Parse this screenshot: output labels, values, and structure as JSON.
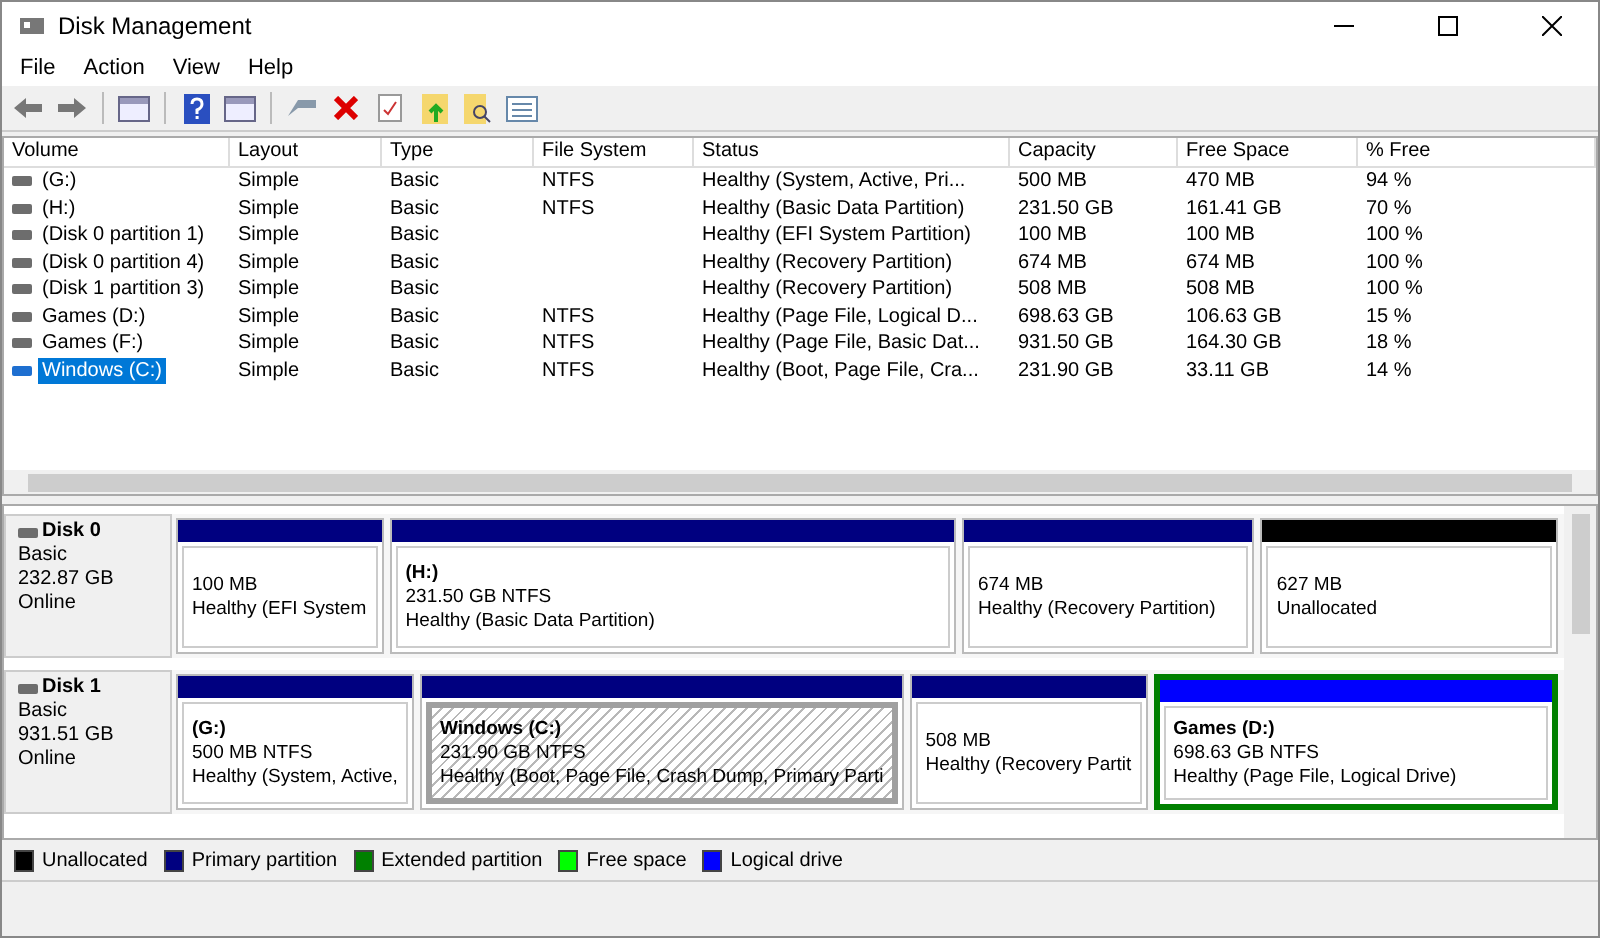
{
  "window": {
    "title": "Disk Management"
  },
  "menu": [
    "File",
    "Action",
    "View",
    "Help"
  ],
  "table": {
    "columns": [
      "Volume",
      "Layout",
      "Type",
      "File System",
      "Status",
      "Capacity",
      "Free Space",
      "% Free"
    ],
    "rows": [
      {
        "cells": [
          "(G:)",
          "Simple",
          "Basic",
          "NTFS",
          "Healthy (System, Active, Pri...",
          "500 MB",
          "470 MB",
          "94 %"
        ],
        "selected": false
      },
      {
        "cells": [
          "(H:)",
          "Simple",
          "Basic",
          "NTFS",
          "Healthy (Basic Data Partition)",
          "231.50 GB",
          "161.41 GB",
          "70 %"
        ],
        "selected": false
      },
      {
        "cells": [
          "(Disk 0 partition 1)",
          "Simple",
          "Basic",
          "",
          "Healthy (EFI System Partition)",
          "100 MB",
          "100 MB",
          "100 %"
        ],
        "selected": false
      },
      {
        "cells": [
          "(Disk 0 partition 4)",
          "Simple",
          "Basic",
          "",
          "Healthy (Recovery Partition)",
          "674 MB",
          "674 MB",
          "100 %"
        ],
        "selected": false
      },
      {
        "cells": [
          "(Disk 1 partition 3)",
          "Simple",
          "Basic",
          "",
          "Healthy (Recovery Partition)",
          "508 MB",
          "508 MB",
          "100 %"
        ],
        "selected": false
      },
      {
        "cells": [
          "Games (D:)",
          "Simple",
          "Basic",
          "NTFS",
          "Healthy (Page File, Logical D...",
          "698.63 GB",
          "106.63 GB",
          "15 %"
        ],
        "selected": false
      },
      {
        "cells": [
          "Games (F:)",
          "Simple",
          "Basic",
          "NTFS",
          "Healthy (Page File, Basic Dat...",
          "931.50 GB",
          "164.30 GB",
          "18 %"
        ],
        "selected": false
      },
      {
        "cells": [
          "Windows (C:)",
          "Simple",
          "Basic",
          "NTFS",
          "Healthy (Boot, Page File, Cra...",
          "231.90 GB",
          "33.11 GB",
          "14 %"
        ],
        "selected": true
      }
    ]
  },
  "disks": [
    {
      "name": "Disk 0",
      "type": "Basic",
      "size": "232.87 GB",
      "state": "Online",
      "partitions": [
        {
          "lines": [
            "100 MB",
            "Healthy (EFI System"
          ],
          "color": "#000080",
          "selected": false,
          "extended": false
        },
        {
          "title": "(H:)",
          "lines": [
            "231.50 GB NTFS",
            "Healthy (Basic Data Partition)"
          ],
          "color": "#000080",
          "selected": false,
          "extended": false
        },
        {
          "lines": [
            "674 MB",
            "Healthy (Recovery Partition)"
          ],
          "color": "#000080",
          "selected": false,
          "extended": false
        },
        {
          "lines": [
            "627 MB",
            "Unallocated"
          ],
          "color": "#000000",
          "selected": false,
          "extended": false
        }
      ]
    },
    {
      "name": "Disk 1",
      "type": "Basic",
      "size": "931.51 GB",
      "state": "Online",
      "partitions": [
        {
          "title": "(G:)",
          "lines": [
            "500 MB NTFS",
            "Healthy (System, Active,"
          ],
          "color": "#000080",
          "selected": false,
          "extended": false
        },
        {
          "title": "Windows  (C:)",
          "lines": [
            "231.90 GB NTFS",
            "Healthy (Boot, Page File, Crash Dump, Primary Parti"
          ],
          "color": "#000080",
          "selected": true,
          "extended": false
        },
        {
          "lines": [
            "508 MB",
            "Healthy (Recovery Partit"
          ],
          "color": "#000080",
          "selected": false,
          "extended": false
        },
        {
          "title": "Games  (D:)",
          "lines": [
            "698.63 GB NTFS",
            "Healthy (Page File, Logical Drive)"
          ],
          "color": "#0000ff",
          "selected": false,
          "extended": true
        }
      ]
    }
  ],
  "legend": [
    {
      "label": "Unallocated",
      "color": "#000000"
    },
    {
      "label": "Primary partition",
      "color": "#000080"
    },
    {
      "label": "Extended partition",
      "color": "#008000"
    },
    {
      "label": "Free space",
      "color": "#00ff00"
    },
    {
      "label": "Logical drive",
      "color": "#0000ff"
    }
  ]
}
